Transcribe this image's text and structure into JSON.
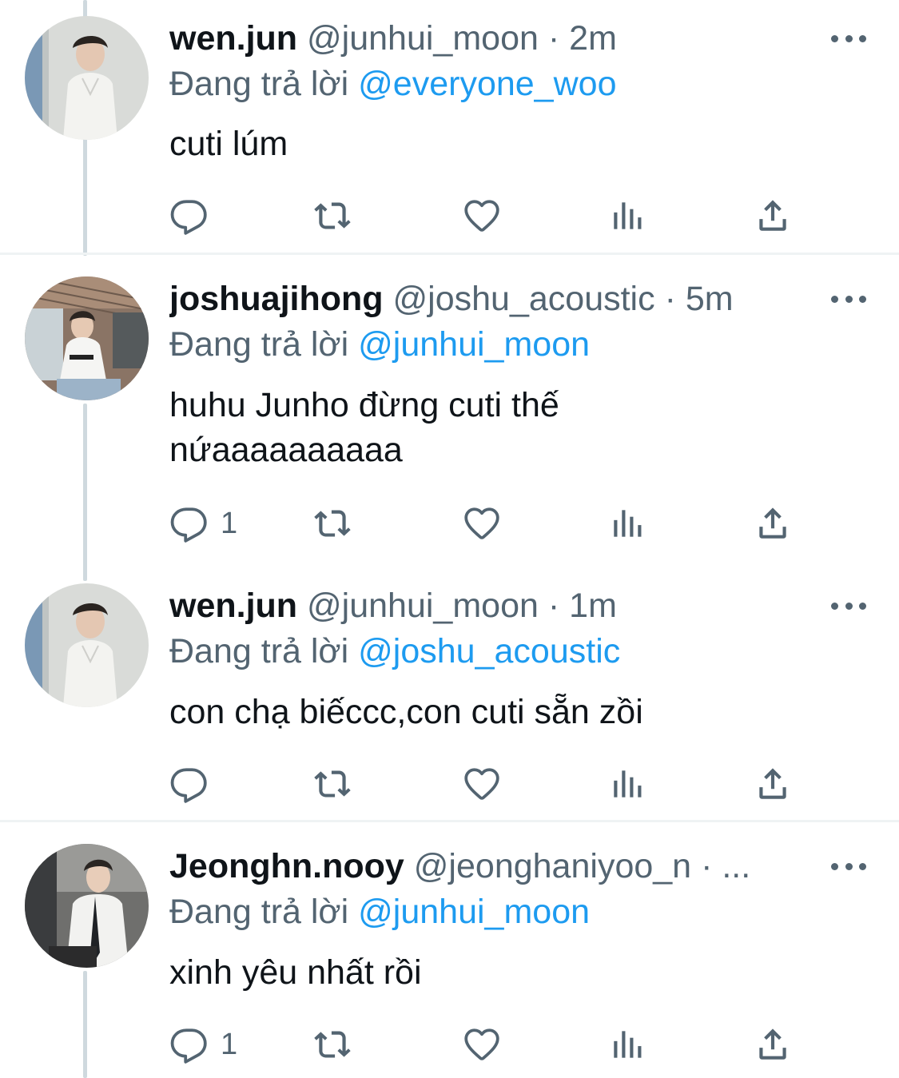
{
  "tweets": [
    {
      "name": "wen.jun",
      "handle": "@junhui_moon",
      "separator": "·",
      "time": "2m",
      "reply_prefix": "Đang trả lời",
      "reply_to": "@everyone_woo",
      "text": "cuti lúm",
      "reply_count": "",
      "avatar": "avatar-wen-jun"
    },
    {
      "name": "joshuajihong",
      "handle": "@joshu_acoustic",
      "separator": "·",
      "time": "5m",
      "reply_prefix": "Đang trả lời",
      "reply_to": "@junhui_moon",
      "text_line1": "huhu Junho đừng cuti thế",
      "text_line2": "nứaaaaaaaaaa",
      "reply_count": "1",
      "avatar": "avatar-joshuajihong"
    },
    {
      "name": "wen.jun",
      "handle": "@junhui_moon",
      "separator": "·",
      "time": "1m",
      "reply_prefix": "Đang trả lời",
      "reply_to": "@joshu_acoustic",
      "text": "con chạ biếccc,con cuti sẵn zồi",
      "reply_count": "",
      "avatar": "avatar-wen-jun"
    },
    {
      "name": "Jeonghn.nooy",
      "handle": "@jeonghaniyoo_n",
      "separator": "·",
      "time": "...",
      "reply_prefix": "Đang trả lời",
      "reply_to": "@junhui_moon",
      "text": "xinh yêu nhất rồi",
      "reply_count": "1",
      "avatar": "avatar-jeonghn-nooy"
    }
  ],
  "icons": {
    "reply": "reply-icon",
    "retweet": "retweet-icon",
    "like": "heart-icon",
    "views": "views-icon",
    "share": "share-icon",
    "more": "more-icon"
  },
  "colors": {
    "text": "#0f1419",
    "secondary": "#536471",
    "link": "#1d9bf0",
    "thread_line": "#cfd9de",
    "divider": "#eff3f4"
  }
}
